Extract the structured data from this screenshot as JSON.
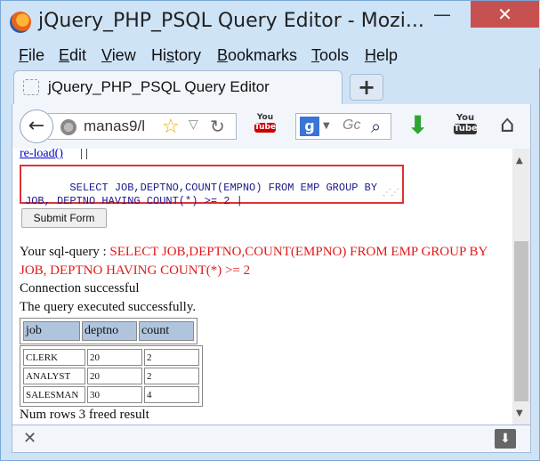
{
  "window": {
    "title": "jQuery_PHP_PSQL Query Editor - Mozi...",
    "minimize_glyph": "—",
    "close_glyph": "✕"
  },
  "menu": {
    "items": [
      {
        "label": "File",
        "key": "F",
        "rest": "ile"
      },
      {
        "label": "Edit",
        "key": "E",
        "rest": "dit"
      },
      {
        "label": "View",
        "key": "V",
        "rest": "iew"
      },
      {
        "label": "History",
        "pre": "Hi",
        "key": "s",
        "rest": "tory"
      },
      {
        "label": "Bookmarks",
        "key": "B",
        "rest": "ookmarks"
      },
      {
        "label": "Tools",
        "key": "T",
        "rest": "ools"
      },
      {
        "label": "Help",
        "key": "H",
        "rest": "elp"
      }
    ]
  },
  "tab": {
    "label": "jQuery_PHP_PSQL Query Editor",
    "new_tab_glyph": "+"
  },
  "navbar": {
    "url": "manas9/l",
    "search_placeholder": "Gc",
    "youtube1_top": "You",
    "youtube1_bottom": "Tube",
    "youtube2_top": "You",
    "youtube2_bottom": "Tube"
  },
  "page": {
    "reload_link": "re-load()",
    "reload_separator": "| |",
    "query_text": " SELECT JOB,DEPTNO,COUNT(EMPNO) FROM EMP GROUP BY\nJOB, DEPTNO HAVING COUNT(*) >= 2 |",
    "submit_label": "Submit Form",
    "sql_label": "Your sql-query : ",
    "sql_query": "SELECT JOB,DEPTNO,COUNT(EMPNO) FROM EMP GROUP BY JOB, DEPTNO HAVING COUNT(*) >= 2",
    "connection_msg": "Connection successful",
    "exec_msg": "The query executed successfully.",
    "headers": [
      "job",
      "deptno",
      "count"
    ],
    "rows": [
      [
        "CLERK",
        "20",
        "2"
      ],
      [
        "ANALYST",
        "20",
        "2"
      ],
      [
        "SALESMAN",
        "30",
        "4"
      ]
    ],
    "rows_msg": "Num rows 3 freed result"
  },
  "colors": {
    "query_color": "#e01a1a",
    "header_bg": "#b0c4de",
    "query_box_border": "#dd3333"
  },
  "icons": [
    "firefox-logo",
    "back-arrow-icon",
    "globe-icon",
    "star-icon",
    "reload-icon",
    "youtube-icon",
    "google-icon",
    "search-icon",
    "download-icon",
    "home-icon",
    "close-icon",
    "download-manager-icon"
  ]
}
